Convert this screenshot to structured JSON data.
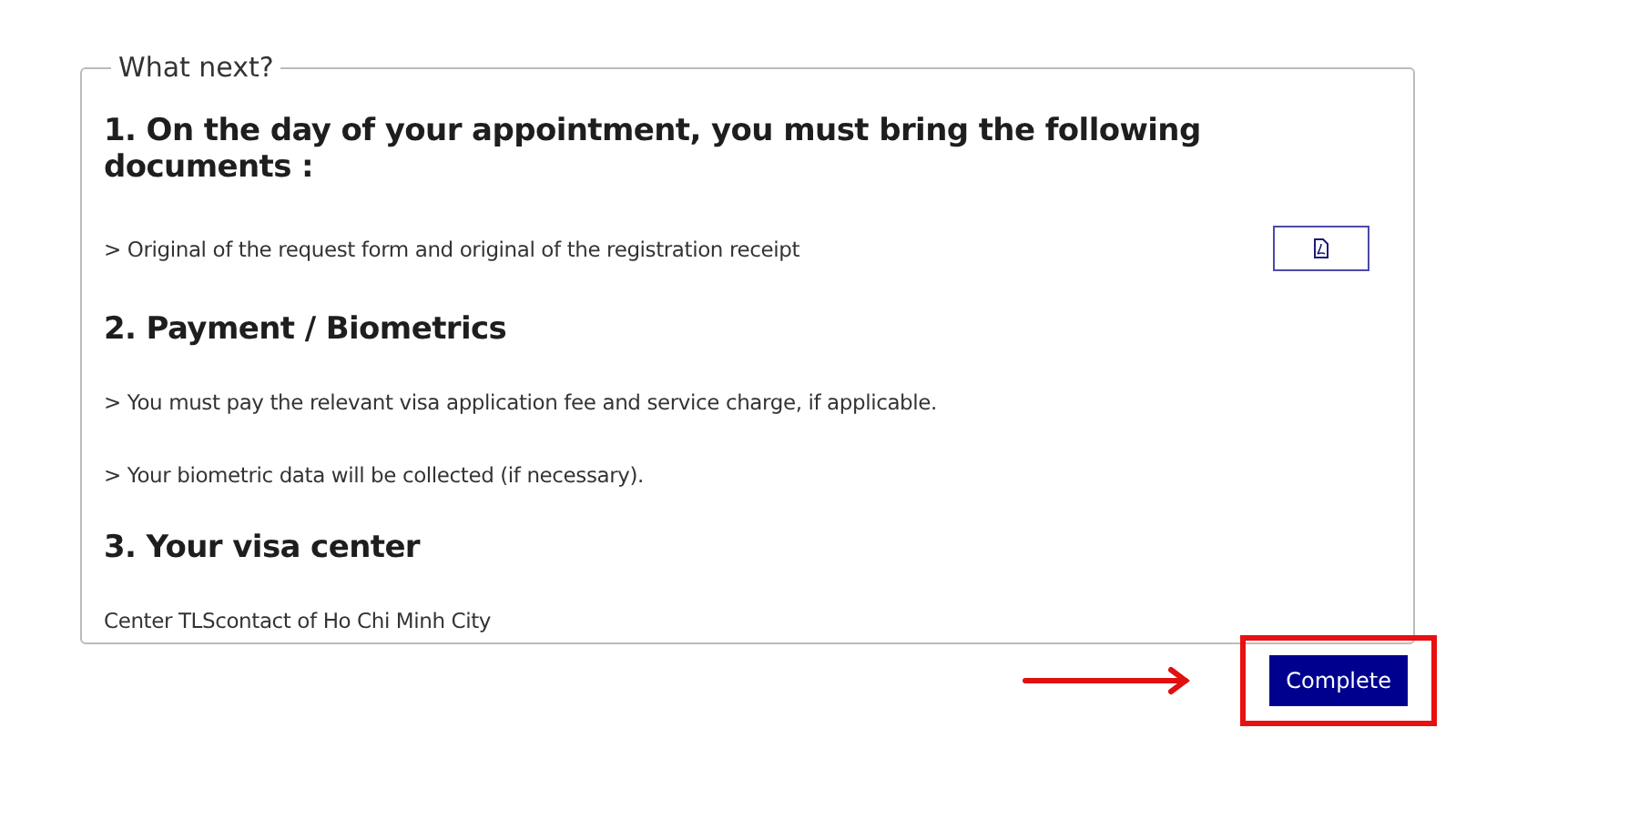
{
  "panel": {
    "legend": "What next?",
    "sections": [
      {
        "heading": "1. On the day of your appointment, you must bring the following documents :",
        "lines": [
          {
            "text": "> Original of the request form and original of the registration receipt",
            "download": true
          }
        ]
      },
      {
        "heading": "2. Payment / Biometrics",
        "lines": [
          {
            "text": "> You must pay the relevant visa application fee and service charge, if applicable.",
            "download": false
          },
          {
            "text": "> Your biometric data will be collected (if necessary).",
            "download": false
          }
        ]
      },
      {
        "heading": "3. Your visa center",
        "lines": [
          {
            "text": "Center TLScontact of Ho Chi Minh City",
            "download": false
          }
        ]
      }
    ]
  },
  "action": {
    "label": "Complete",
    "highlighted": true
  }
}
